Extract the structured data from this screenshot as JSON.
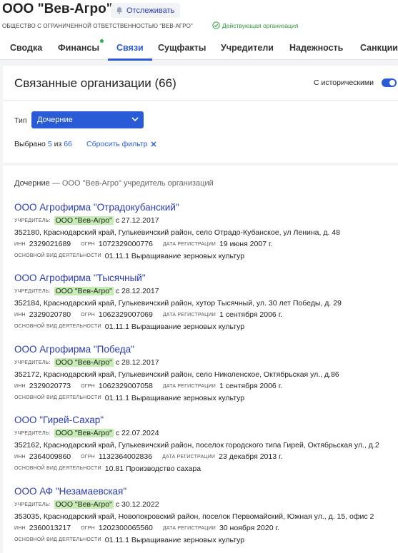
{
  "header": {
    "company_title": "ООО \"Вев-Агро\"",
    "track_label": "Отслеживать",
    "legal_name": "ОБЩЕСТВО С ОГРАНИЧЕННОЙ ОТВЕТСТВЕННОСТЬЮ \"ВЕВ-АГРО\"",
    "status": "Действующая организация",
    "status_color": "#2e9a3a"
  },
  "tabs": [
    {
      "label": "Сводка",
      "active": false
    },
    {
      "label": "Финансы",
      "active": false,
      "dot": true
    },
    {
      "label": "Связи",
      "active": true
    },
    {
      "label": "Сущфакты",
      "active": false
    },
    {
      "label": "Учредители",
      "active": false
    },
    {
      "label": "Надежность",
      "active": false
    },
    {
      "label": "Санкции",
      "active": false
    }
  ],
  "panel": {
    "title": "Связанные организации (66)",
    "historical_label": "С историческими",
    "historical_enabled": true,
    "type_label": "Тип",
    "type_value": "Дочерние",
    "selected_prefix": "Выбрано",
    "selected_count": "5",
    "selected_of": "из",
    "total_count": "66",
    "reset_label": "Сбросить фильтр"
  },
  "section": {
    "heading": "Дочерние",
    "description": " — ООО \"Вев-Агро\" учредитель организаций"
  },
  "labels": {
    "founder": "УЧРЕДИТЕЛЬ:",
    "inn": "ИНН",
    "ogrn": "ОГРН",
    "reg_date": "ДАТА РЕГИСТРАЦИИ",
    "activity": "ОСНОВНОЙ ВИД ДЕЯТЕЛЬНОСТИ"
  },
  "organizations": [
    {
      "name": "ООО Агрофирма \"Отрадокубанский\"",
      "founder": "ООО \"Вев-Агро\"",
      "founder_since": "с 27.12.2017",
      "address": "352180, Краснодарский край, Гулькевичский район, село Отрадо-Кубанское, ул Ленина, д. 48",
      "inn": "2329021689",
      "ogrn": "1072329000776",
      "reg_date": "19 июня 2007 г.",
      "activity": "01.11.1 Выращивание зерновых культур"
    },
    {
      "name": "ООО Агрофирма \"Тысячный\"",
      "founder": "ООО \"Вев-Агро\"",
      "founder_since": "с 28.12.2017",
      "address": "352184, Краснодарский край, Гулькевичский район, хутор Тысячный, ул. 30 лет Победы, д. 29",
      "inn": "2329020780",
      "ogrn": "1062329007069",
      "reg_date": "1 сентября 2006 г.",
      "activity": "01.11.1 Выращивание зерновых культур"
    },
    {
      "name": "ООО Агрофирма \"Победа\"",
      "founder": "ООО \"Вев-Агро\"",
      "founder_since": "с 28.12.2017",
      "address": "352172, Краснодарский край, Гулькевичский район, село Николенское, Октябрьская ул., д.86",
      "inn": "2329020773",
      "ogrn": "1062329007058",
      "reg_date": "1 сентября 2006 г.",
      "activity": "01.11.1 Выращивание зерновых культур"
    },
    {
      "name": "ООО \"Гирей-Сахар\"",
      "founder": "ООО \"Вев-Агро\"",
      "founder_since": "с 22.07.2024",
      "address": "352162, Краснодарский край, Гулькевичский район, поселок городского типа Гирей, Октябрьская ул., д.2",
      "inn": "2364009860",
      "ogrn": "1132364002836",
      "reg_date": "23 декабря 2013 г.",
      "activity": "10.81 Производство сахара"
    },
    {
      "name": "ООО АФ \"Незамаевская\"",
      "founder": "ООО \"Вев-Агро\"",
      "founder_since": "с 30.12.2022",
      "address": "353035, Краснодарский край, Новопокровский район, поселок Первомайский, Южная ул., д. 15, офис 2",
      "inn": "2360013217",
      "ogrn": "1202300065560",
      "reg_date": "30 ноября 2020 г.",
      "activity": "01.11.1 Выращивание зерновых культур"
    }
  ],
  "icons": {
    "track": "bell-icon",
    "status": "check-circle-icon",
    "select": "chevron-down-icon",
    "reset": "close-icon"
  },
  "colors": {
    "accent": "#2a5bd7",
    "link": "#2a3cb0",
    "highlight": "#c5ecb3"
  }
}
